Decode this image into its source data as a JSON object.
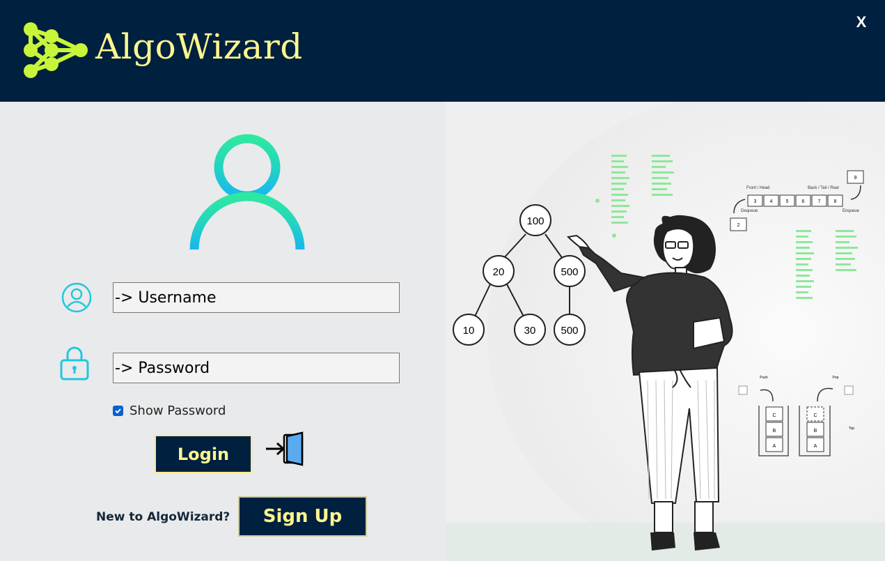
{
  "app": {
    "brand_name": "AlgoWizard",
    "close_label": "X",
    "colors": {
      "header_bg": "#00203f",
      "brand": "#fcf68f",
      "accent_green": "#c8f53a",
      "avatar_top": "#2ee8a0",
      "avatar_bottom": "#18b6f0"
    }
  },
  "icons": {
    "logo": "neural-network-icon",
    "user": "user-icon",
    "lock": "lock-icon",
    "door": "door-exit-icon"
  },
  "form": {
    "username_placeholder": "-> Username",
    "password_placeholder": "-> Password",
    "show_password_label": "Show Password",
    "show_password_checked": true,
    "login_label": "Login",
    "new_user_text": "New to AlgoWizard?",
    "signup_label": "Sign Up"
  },
  "illustration": {
    "tree_nodes": [
      "100",
      "20",
      "500",
      "10",
      "30",
      "500"
    ],
    "queue_cells": [
      "3",
      "4",
      "5",
      "6",
      "7",
      "8"
    ],
    "queue_front_label": "Front / Head",
    "queue_back_label": "Back / Tail / Rear",
    "queue_dequeue_label": "Dequeue",
    "queue_enqueue_label": "Enqueue",
    "queue_in": "9",
    "queue_out": "2",
    "stack_left": [
      "C",
      "B",
      "A"
    ],
    "stack_right": [
      "C",
      "B",
      "A"
    ],
    "stack_push_label": "Push",
    "stack_pop_label": "Pop",
    "stack_top_label": "Top"
  }
}
